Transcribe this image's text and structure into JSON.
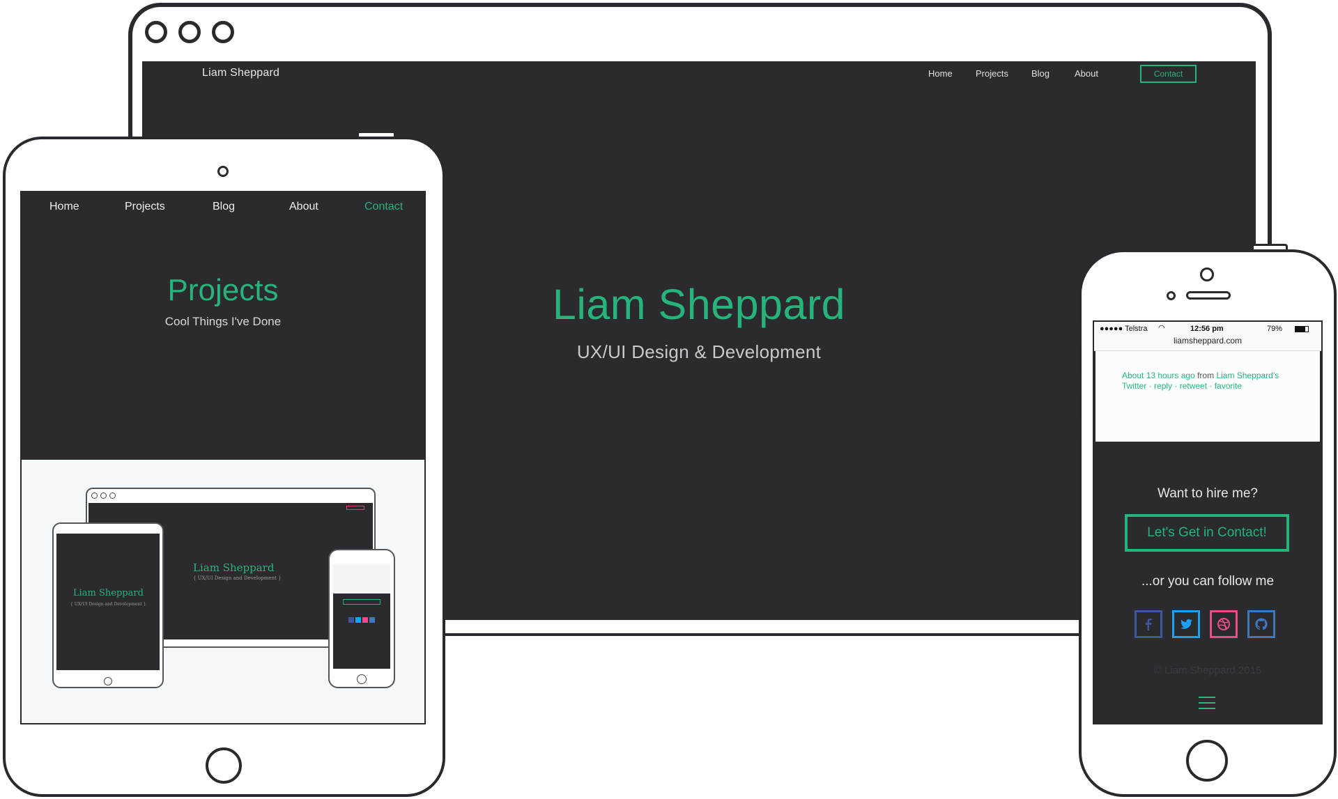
{
  "desktop": {
    "brand": "Liam Sheppard",
    "nav": [
      "Home",
      "Projects",
      "Blog",
      "About"
    ],
    "contact_label": "Contact",
    "hero_title": "Liam Sheppard",
    "hero_subtitle": "UX/UI Design & Development"
  },
  "tablet": {
    "nav": [
      "Home",
      "Projects",
      "Blog",
      "About",
      "Contact"
    ],
    "title": "Projects",
    "subtitle": "Cool Things I've Done",
    "showcase": {
      "mini_monitor_title": "Liam Sheppard",
      "mini_monitor_subtitle": "{ UX/UI Design and Development }",
      "mini_tablet_title": "Liam Sheppard",
      "mini_tablet_subtitle": "{ UX/UI Design and Development }"
    }
  },
  "phone": {
    "status": {
      "carrier": "●●●●● Telstra",
      "time": "12:56 pm",
      "battery": "79%"
    },
    "url": "liamsheppard.com",
    "tweet": {
      "time": "About 13 hours ago",
      "from": "from",
      "source": "Liam Sheppard's Twitter",
      "actions": "· reply · retweet · favorite"
    },
    "hire_text": "Want to hire me?",
    "cta_label": "Let's Get in Contact!",
    "follow_text": "...or you can follow me",
    "social": [
      {
        "name": "facebook-icon",
        "color": "#3b5998",
        "glyph": "f"
      },
      {
        "name": "twitter-icon",
        "color": "#1da1f2",
        "glyph": "t"
      },
      {
        "name": "dribbble-icon",
        "color": "#ea4c89",
        "glyph": "◎"
      },
      {
        "name": "github-icon",
        "color": "#4078c0",
        "glyph": "◉"
      }
    ],
    "copyright": "© Liam Sheppard 2015"
  },
  "colors": {
    "accent": "#27b47a",
    "screen_bg": "#2b2a2f",
    "device_outline": "#2a2a2e"
  }
}
